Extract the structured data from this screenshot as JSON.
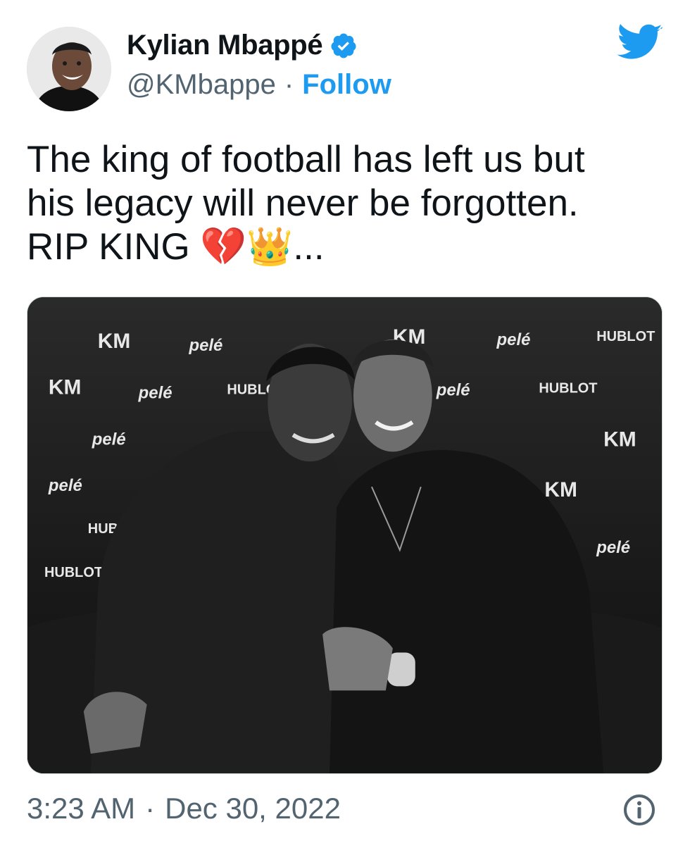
{
  "author": {
    "display_name": "Kylian Mbappé",
    "handle": "@KMbappe",
    "separator": "·",
    "follow_label": "Follow",
    "avatar_icon": "profile-photo",
    "verified_icon": "verified-badge-icon"
  },
  "brand": {
    "icon": "twitter-bird-icon",
    "color": "#1d9bf0"
  },
  "tweet": {
    "line1": "The king of football has left us but",
    "line2": "his legacy will never be forgotten.",
    "line3_text": "RIP KING ",
    "emoji_broken_heart": "💔",
    "emoji_crown": "👑",
    "ellipsis": "..."
  },
  "media": {
    "description_icon": "photo",
    "backdrop_logos": [
      "HUBLOT",
      "KM",
      "pelé"
    ]
  },
  "footer": {
    "time": "3:23 AM",
    "separator": "·",
    "date": "Dec 30, 2022",
    "info_icon": "info-icon"
  },
  "colors": {
    "link": "#1d9bf0",
    "secondary_text": "#536471",
    "text": "#0f1419"
  }
}
